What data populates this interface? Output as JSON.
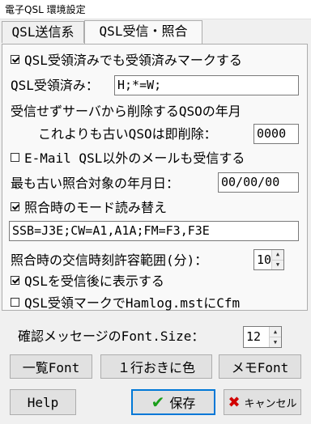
{
  "window": {
    "title": "電子QSL 環境設定"
  },
  "tabs": [
    {
      "label": "QSL送信系",
      "active": false
    },
    {
      "label": "QSL受信・照合",
      "active": true
    }
  ],
  "settings": {
    "received_mark_checkbox": {
      "label": "QSL受領済みでも受領済みマークする",
      "checked": true
    },
    "received_mark_label": "QSL受領済み：",
    "received_mark_value": "H;*=W;",
    "delete_year_label": "受信せずサーバから削除するQSOの年月",
    "delete_older_label": "これよりも古いQSOは即削除：",
    "delete_older_value": "0000",
    "email_checkbox": {
      "label": "E-Mail QSL以外のメールも受信する",
      "checked": false
    },
    "oldest_date_label": "最も古い照合対象の年月日：",
    "oldest_date_value": "00/00/00",
    "mode_rewrite_checkbox": {
      "label": "照合時のモード読み替え",
      "checked": true
    },
    "mode_rewrite_value": "SSB=J3E;CW=A1,A1A;FM=F3,F3E",
    "time_tolerance_label": "照合時の交信時刻許容範囲(分)：",
    "time_tolerance_value": "10",
    "show_after_receive_checkbox": {
      "label": "QSLを受信後に表示する",
      "checked": true
    },
    "cfm_checkbox": {
      "label": "QSL受領マークでHamlog.mstにCfm",
      "checked": false
    }
  },
  "footer": {
    "font_size_label": "確認メッセージのFont.Size：",
    "font_size_value": "12",
    "list_font_button": "一覧Font",
    "alt_color_button": "１行おきに色",
    "memo_font_button": "メモFont",
    "help_button": "Help",
    "save_button": "保存",
    "cancel_button": "キャンセル"
  }
}
